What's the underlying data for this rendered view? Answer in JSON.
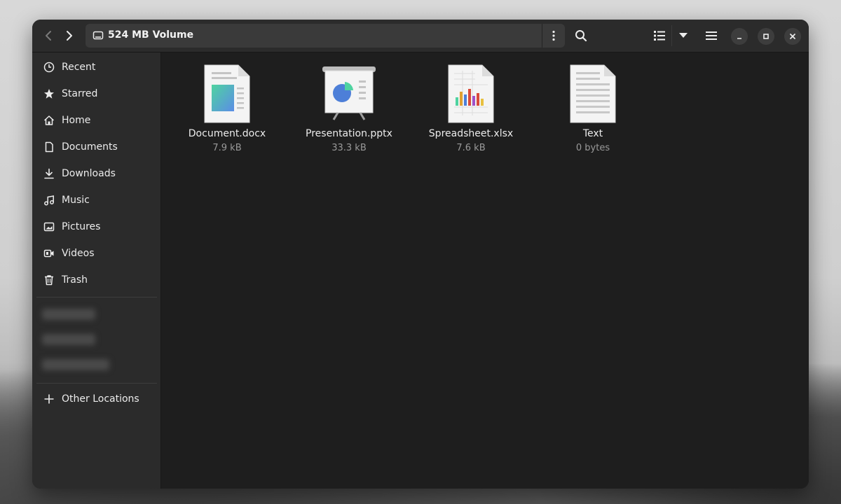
{
  "window": {
    "title": "524 MB Volume"
  },
  "header": {
    "path_label": "524 MB Volume",
    "icons": [
      "back-arrow-icon",
      "forward-arrow-icon",
      "drive-icon",
      "kebab-menu-icon",
      "search-icon",
      "list-view-icon",
      "dropdown-arrow-icon",
      "hamburger-menu-icon",
      "minimize-icon",
      "maximize-icon",
      "close-icon"
    ]
  },
  "sidebar": {
    "items": [
      {
        "label": "Recent",
        "icon": "clock-icon"
      },
      {
        "label": "Starred",
        "icon": "star-icon"
      },
      {
        "label": "Home",
        "icon": "home-icon"
      },
      {
        "label": "Documents",
        "icon": "document-icon"
      },
      {
        "label": "Downloads",
        "icon": "download-icon"
      },
      {
        "label": "Music",
        "icon": "music-icon"
      },
      {
        "label": "Pictures",
        "icon": "picture-icon"
      },
      {
        "label": "Videos",
        "icon": "video-icon"
      },
      {
        "label": "Trash",
        "icon": "trash-icon"
      }
    ],
    "other_locations": "Other Locations"
  },
  "files": [
    {
      "name": "Document.docx",
      "size": "7.9 kB",
      "icon": "word-document-icon"
    },
    {
      "name": "Presentation.pptx",
      "size": "33.3 kB",
      "icon": "presentation-icon"
    },
    {
      "name": "Spreadsheet.xlsx",
      "size": "7.6 kB",
      "icon": "spreadsheet-icon"
    },
    {
      "name": "Text",
      "size": "0 bytes",
      "icon": "text-file-icon"
    }
  ],
  "colors": {
    "window_bg": "#1e1e1e",
    "sidebar_bg": "#2b2b2b",
    "text": "#ececec",
    "muted": "#9a9a9a"
  }
}
